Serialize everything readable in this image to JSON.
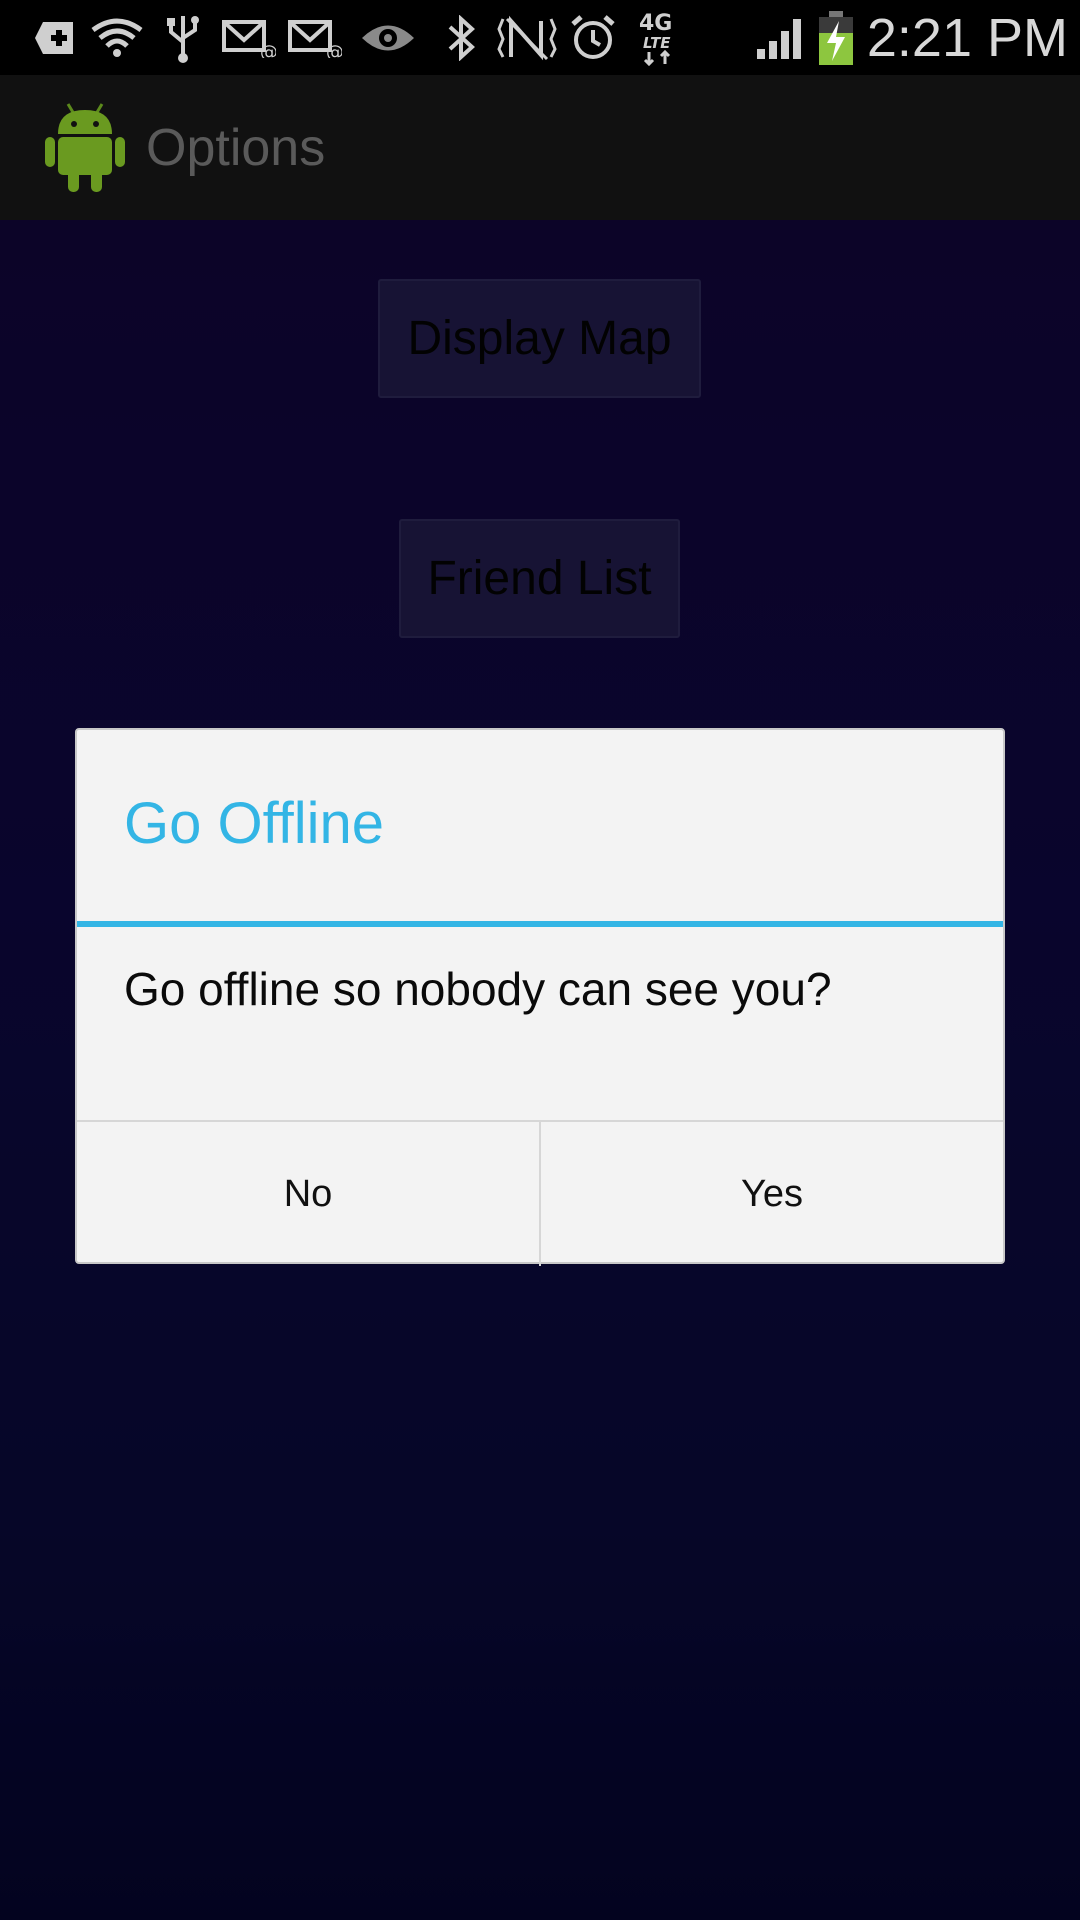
{
  "status_bar": {
    "time": "2:21 PM",
    "icons": [
      "add-icon",
      "wifi-icon",
      "usb-icon",
      "email-icon",
      "email-icon",
      "eye-icon",
      "bluetooth-icon",
      "nfc-icon",
      "alarm-icon",
      "4g-lte-icon",
      "signal-icon",
      "battery-charging-icon"
    ],
    "lte_label": "4G"
  },
  "action_bar": {
    "title": "Options"
  },
  "main": {
    "display_map_label": "Display Map",
    "friend_list_label": "Friend List"
  },
  "dialog": {
    "title": "Go Offline",
    "message": "Go offline so nobody can see you?",
    "no_label": "No",
    "yes_label": "Yes"
  },
  "colors": {
    "accent": "#33b5e5",
    "background": "#120a52",
    "dialog_bg": "#f3f3f3"
  }
}
